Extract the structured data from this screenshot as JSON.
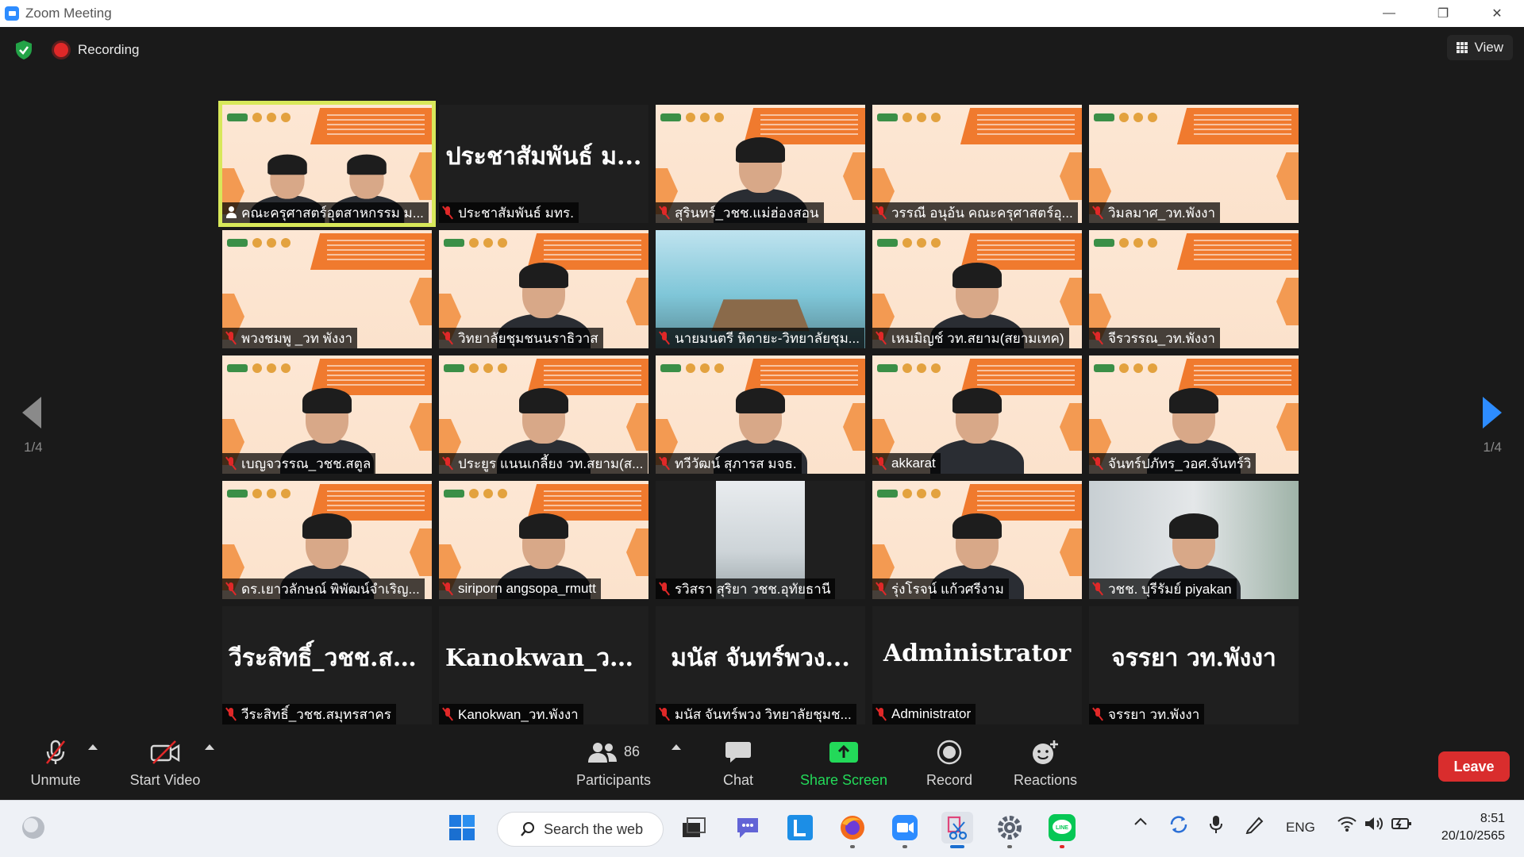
{
  "window": {
    "title": "Zoom Meeting",
    "minimize": "—",
    "restore": "❐",
    "close": "✕"
  },
  "top": {
    "recording_label": "Recording",
    "view_label": "View"
  },
  "pager": {
    "left": "1/4",
    "right": "1/4"
  },
  "tiles": [
    {
      "label": "คณะครุศาสตร์อุตสาหกรรม ม...",
      "kind": "slide2"
    },
    {
      "label": "ประชาสัมพันธ์ มทร.",
      "kind": "name",
      "display": "ประชาสัมพันธ์ ม..."
    },
    {
      "label": "สุรินทร์_วชช.แม่ฮ่องสอน",
      "kind": "person"
    },
    {
      "label": "วรรณี  อนุอ้น คณะครุศาสตร์อุ...",
      "kind": "slide"
    },
    {
      "label": "วิมลมาศ_วท.พังงา",
      "kind": "slide"
    },
    {
      "label": "พวงชมพู _วท พังงา",
      "kind": "slide"
    },
    {
      "label": "วิทยาลัยชุมชนนราธิวาส",
      "kind": "person"
    },
    {
      "label": "นายมนตรี หิตายะ-วิทยาลัยชุม...",
      "kind": "room"
    },
    {
      "label": "เหมมิญช์ วท.สยาม(สยามเทค)",
      "kind": "person"
    },
    {
      "label": "จีรวรรณ_วท.พังงา",
      "kind": "slide"
    },
    {
      "label": "เบญจวรรณ_วชช.สตูล",
      "kind": "person"
    },
    {
      "label": "ประยูร แนนเกลี้ยง วท.สยาม(ส...",
      "kind": "person"
    },
    {
      "label": "ทวีวัฒน์ สุภารส มจธ.",
      "kind": "person"
    },
    {
      "label": "akkarat",
      "kind": "person"
    },
    {
      "label": "จันทร์ปภัทร_วอศ.จันทร์วิ",
      "kind": "person"
    },
    {
      "label": "ดร.เยาวลักษณ์ พิพัฒน์จำเริญ...",
      "kind": "person"
    },
    {
      "label": "siriporn angsopa_rmutt",
      "kind": "person"
    },
    {
      "label": "รวิสรา สุริยา วชช.อุทัยธานี",
      "kind": "office"
    },
    {
      "label": "รุ่งโรจน์ แก้วศรีงาม",
      "kind": "person"
    },
    {
      "label": "วชช. บุรีรัมย์ piyakan",
      "kind": "office2"
    },
    {
      "label": "วีระสิทธิ์_วชช.สมุทรสาคร",
      "kind": "name",
      "display": "วีระสิทธิ์_วชช.สมุ..."
    },
    {
      "label": "Kanokwan_วท.พังงา",
      "kind": "name",
      "display": "Kanokwan_วท...."
    },
    {
      "label": "มนัส  จันทร์พวง วิทยาลัยชุมช...",
      "kind": "name",
      "display": "มนัส  จันทร์พวง..."
    },
    {
      "label": "Administrator",
      "kind": "name",
      "display": "Administrator"
    },
    {
      "label": "จรรยา วท.พังงา",
      "kind": "name",
      "display": "จรรยา วท.พังงา"
    }
  ],
  "toolbar": {
    "unmute": "Unmute",
    "start_video": "Start Video",
    "participants": "Participants",
    "participants_count": "86",
    "chat": "Chat",
    "share_screen": "Share Screen",
    "record": "Record",
    "reactions": "Reactions",
    "leave": "Leave"
  },
  "taskbar": {
    "search_placeholder": "Search the web",
    "lang": "ENG",
    "time": "8:51",
    "date": "20/10/2565"
  },
  "colors": {
    "accent": "#2d8cff",
    "leave": "#d92d2d",
    "share": "#23d959",
    "active_border": "#d8e85a"
  }
}
